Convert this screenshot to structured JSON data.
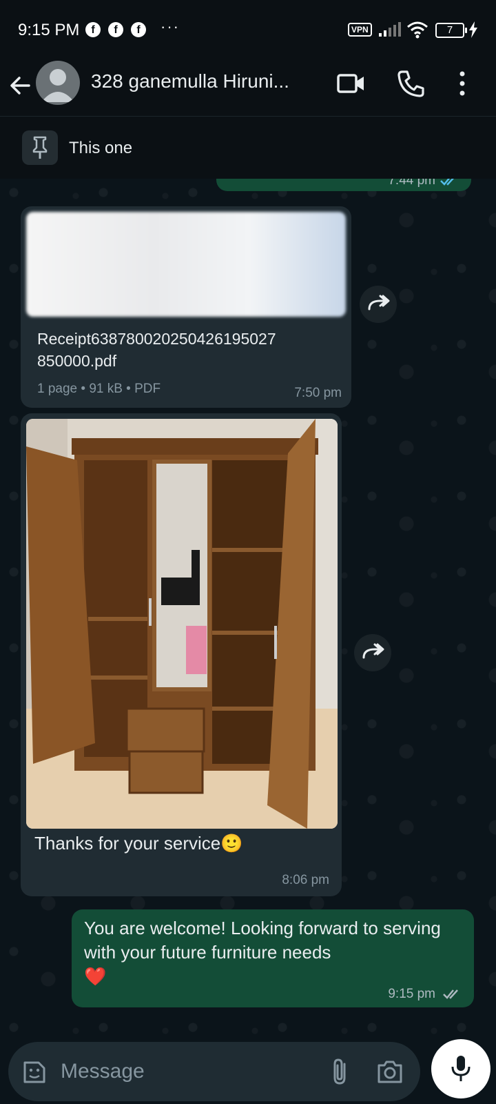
{
  "status_bar": {
    "time": "9:15 PM",
    "notification_icons": [
      "facebook-icon",
      "facebook-icon",
      "facebook-icon"
    ],
    "more_dots": "···",
    "vpn_label": "VPN",
    "battery_level": "7"
  },
  "header": {
    "contact_name": "328 ganemulla Hiruni...",
    "icons": [
      "back-arrow-icon",
      "video-call-icon",
      "voice-call-icon",
      "more-options-icon"
    ]
  },
  "pinned": {
    "text": "This one"
  },
  "messages": {
    "cut_off": {
      "time": "7:44 pm",
      "status": "read"
    },
    "document": {
      "filename": "Receipt638780020250426195027850000.pdf",
      "filename_line1": "Receipt63878002025042619502​7",
      "filename_line2": "850000.pdf",
      "meta": "1 page • 91 kB • PDF",
      "time": "7:50 pm"
    },
    "photo": {
      "caption": "Thanks for your service",
      "caption_emoji": "🙂",
      "time": "8:06 pm"
    },
    "outgoing": {
      "text": "You are welcome! Looking forward to serving with your future furniture needs",
      "emoji": "❤️",
      "time": "9:15 pm",
      "status": "delivered"
    }
  },
  "composer": {
    "placeholder": "Message",
    "icons": [
      "sticker-icon",
      "attach-icon",
      "camera-icon",
      "mic-icon"
    ]
  },
  "colors": {
    "background": "#0b141a",
    "incoming_bubble": "#202c33",
    "outgoing_bubble": "#134d37",
    "read_ticks": "#53bdeb",
    "meta_text": "#8696a0"
  }
}
